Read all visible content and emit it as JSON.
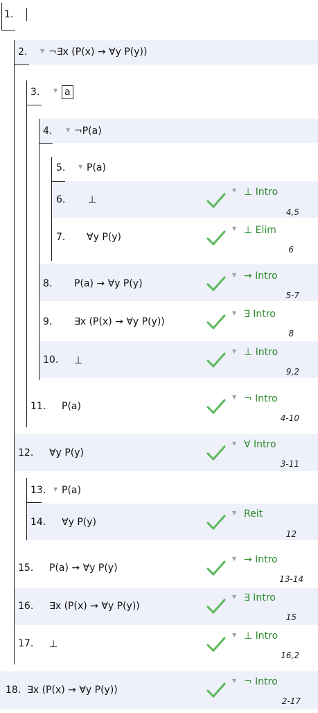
{
  "lines": [
    {
      "num": "1.",
      "formula": ""
    },
    {
      "num": "2.",
      "formula": "¬∃x (P(x) → ∀y P(y))"
    },
    {
      "num": "3.",
      "formula": "a"
    },
    {
      "num": "4.",
      "formula": "¬P(a)"
    },
    {
      "num": "5.",
      "formula": "P(a)"
    },
    {
      "num": "6.",
      "formula": "⊥",
      "rule": "⊥ Intro",
      "cite": "4,5"
    },
    {
      "num": "7.",
      "formula": "∀y P(y)",
      "rule": "⊥ Elim",
      "cite": "6"
    },
    {
      "num": "8.",
      "formula": "P(a) → ∀y P(y)",
      "rule": "→ Intro",
      "cite": "5-7"
    },
    {
      "num": "9.",
      "formula": "∃x (P(x) → ∀y P(y))",
      "rule": "∃ Intro",
      "cite": "8"
    },
    {
      "num": "10.",
      "formula": "⊥",
      "rule": "⊥ Intro",
      "cite": "9,2"
    },
    {
      "num": "11.",
      "formula": "P(a)",
      "rule": "¬ Intro",
      "cite": "4-10"
    },
    {
      "num": "12.",
      "formula": "∀y P(y)",
      "rule": "∀ Intro",
      "cite": "3-11"
    },
    {
      "num": "13.",
      "formula": "P(a)"
    },
    {
      "num": "14.",
      "formula": "∀y P(y)",
      "rule": "Reit",
      "cite": "12"
    },
    {
      "num": "15.",
      "formula": "P(a) → ∀y P(y)",
      "rule": "→ Intro",
      "cite": "13-14"
    },
    {
      "num": "16.",
      "formula": "∃x (P(x) → ∀y P(y))",
      "rule": "∃ Intro",
      "cite": "15"
    },
    {
      "num": "17.",
      "formula": "⊥",
      "rule": "⊥ Intro",
      "cite": "16,2"
    },
    {
      "num": "18.",
      "formula": "∃x (P(x) → ∀y P(y))",
      "rule": "¬ Intro",
      "cite": "2-17"
    }
  ],
  "colors": {
    "band": "#eef0fa",
    "rule_text": "#2e8b2e",
    "check": "#5cb85c"
  },
  "icons": {
    "collapse": "triangle-down-icon",
    "justified": "checkmark-icon"
  }
}
